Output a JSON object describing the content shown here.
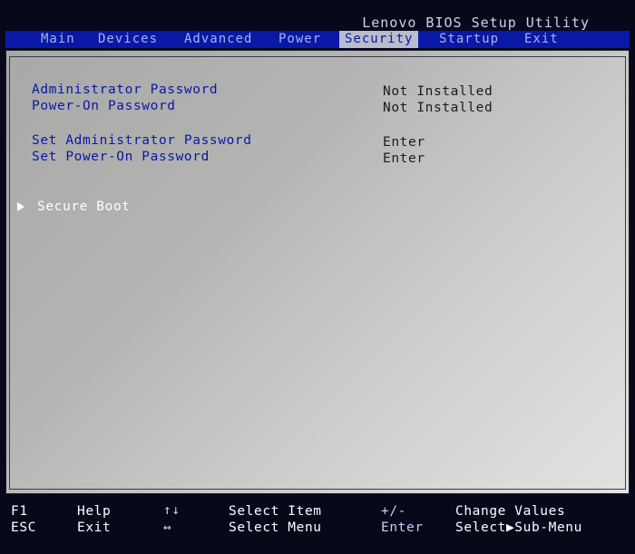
{
  "title": "Lenovo BIOS Setup Utility",
  "tabs": [
    {
      "label": "Main"
    },
    {
      "label": "Devices"
    },
    {
      "label": "Advanced"
    },
    {
      "label": "Power"
    },
    {
      "label": "Security"
    },
    {
      "label": "Startup"
    },
    {
      "label": "Exit"
    }
  ],
  "active_tab": "Security",
  "settings": {
    "admin_password": {
      "label": "Administrator Password",
      "value": "Not Installed"
    },
    "poweron_password": {
      "label": "Power-On Password",
      "value": "Not Installed"
    },
    "set_admin_password": {
      "label": "Set Administrator Password",
      "value": "Enter"
    },
    "set_poweron_password": {
      "label": "Set Power-On Password",
      "value": "Enter"
    }
  },
  "submenu": {
    "label": "Secure Boot"
  },
  "footer": {
    "f1": {
      "key": "F1",
      "action": "Help"
    },
    "esc": {
      "key": "ESC",
      "action": "Exit"
    },
    "updown": {
      "key": "↑↓",
      "action": "Select Item"
    },
    "leftright": {
      "key": "↔",
      "action": "Select Menu"
    },
    "plusminus": {
      "key": "+/-",
      "action": "Change Values"
    },
    "enter": {
      "key": "Enter",
      "action": "Select▶Sub-Menu"
    }
  },
  "colors": {
    "menubar": "#0a18a6",
    "active_tab_bg": "#b9bccd",
    "label_text": "#0a18a6",
    "panel_bg": "#c4c4c2"
  }
}
